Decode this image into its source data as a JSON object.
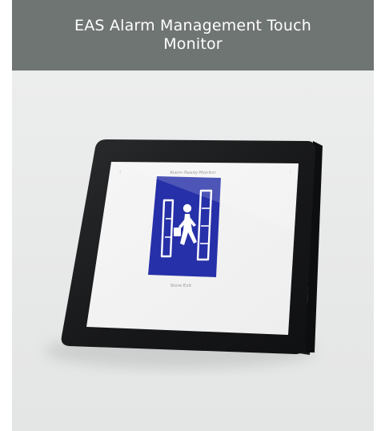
{
  "product": {
    "title": "EAS Alarm Management Touch Monitor"
  },
  "screen": {
    "header_text": "Alarm·Ready·Monitor",
    "caption_text": "Store Exit",
    "icon": "eas-gate-person-icon",
    "icon_bg_color": "#2630a8"
  },
  "colors": {
    "header_bg": "#6f7572",
    "card_bg": "#e9eaea",
    "bezel": "#1b1d1f",
    "accent_strip": "#7fd8b8"
  }
}
